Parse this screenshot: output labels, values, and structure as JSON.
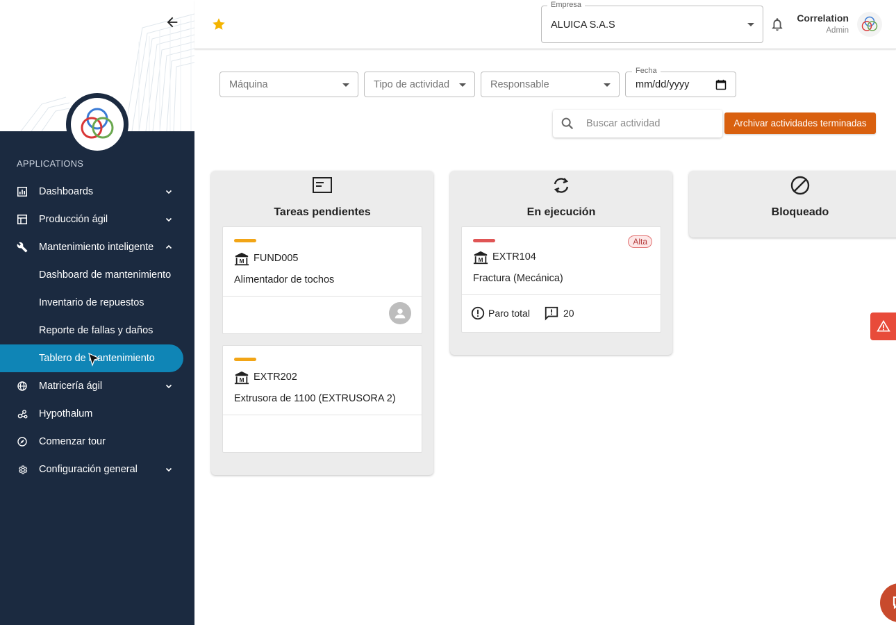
{
  "sidebar": {
    "section_label": "APPLICATIONS",
    "items": [
      {
        "label": "Dashboards",
        "icon": "bar-chart-icon",
        "expandable": true
      },
      {
        "label": "Producción ágil",
        "icon": "table-layout-icon",
        "expandable": true
      },
      {
        "label": "Mantenimiento inteligente",
        "icon": "wrench-icon",
        "expandable": true,
        "expanded": true
      },
      {
        "label": "Dashboard de mantenimiento",
        "sub": true
      },
      {
        "label": "Inventario de repuestos",
        "sub": true
      },
      {
        "label": "Reporte de fallas y daños",
        "sub": true
      },
      {
        "label": "Tablero de mantenimiento",
        "sub": true,
        "active": true
      },
      {
        "label": "Matricería ágil",
        "icon": "globe-icon",
        "expandable": true
      },
      {
        "label": "Hypothalum",
        "icon": "share-nodes-icon",
        "expandable": false
      },
      {
        "label": "Comenzar tour",
        "icon": "compass-icon",
        "expandable": false
      },
      {
        "label": "Configuración general",
        "icon": "gear-icon",
        "expandable": true
      }
    ]
  },
  "header": {
    "company_legend": "Empresa",
    "company_value": "ALUICA S.A.S",
    "user_name": "Correlation",
    "user_role": "Admin"
  },
  "filters": {
    "machine": "Máquina",
    "activity_type": "Tipo de actividad",
    "responsible": "Responsable",
    "date_legend": "Fecha",
    "date_value": "mm/dd/yyyy"
  },
  "search": {
    "placeholder": "Buscar actividad"
  },
  "actions": {
    "archive_label": "Archivar actividades terminadas"
  },
  "columns": [
    {
      "title": "Tareas pendientes",
      "icon": "task-card-icon",
      "cards": [
        {
          "code": "FUND005",
          "description": "Alimentador de tochos",
          "priority_color": "#f2a516"
        },
        {
          "code": "EXTR202",
          "description": "Extrusora de 1100 (EXTRUSORA 2)",
          "priority_color": "#f2a516"
        }
      ]
    },
    {
      "title": "En ejecución",
      "icon": "sync-icon",
      "cards": [
        {
          "code": "EXTR104",
          "description": "Fractura (Mecánica)",
          "priority_color": "#e05555",
          "badge": "Alta",
          "stop_label": "Paro total",
          "comment_count": "20"
        }
      ]
    },
    {
      "title": "Bloqueado",
      "icon": "blocked-icon",
      "cards": []
    }
  ],
  "colors": {
    "sidebar_bg": "#1b2a40",
    "active_item": "#0f85b6",
    "archive_button": "#d9600f",
    "alert_tab": "#e84b3a",
    "star": "#f4b400"
  }
}
